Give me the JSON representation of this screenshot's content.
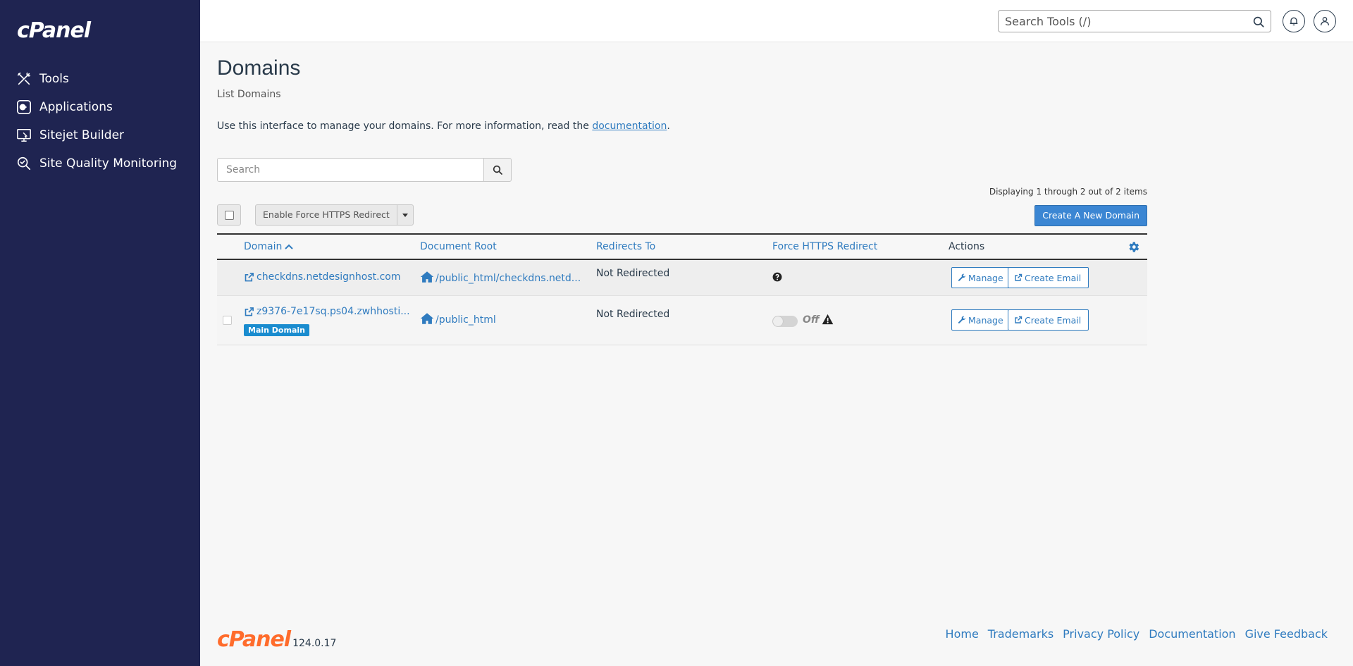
{
  "brand": {
    "logo_text": "cPanel"
  },
  "sidebar": {
    "items": [
      {
        "label": "Tools",
        "icon": "tools-icon"
      },
      {
        "label": "Applications",
        "icon": "applications-icon"
      },
      {
        "label": "Sitejet Builder",
        "icon": "sitejet-icon"
      },
      {
        "label": "Site Quality Monitoring",
        "icon": "site-quality-icon"
      }
    ]
  },
  "topbar": {
    "search_placeholder": "Search Tools (/)",
    "icons": [
      "search-icon",
      "bell-icon",
      "user-icon"
    ]
  },
  "page": {
    "title": "Domains",
    "subtitle": "List Domains",
    "intro_text": "Use this interface to manage your domains. For more information, read the ",
    "intro_link": "documentation",
    "intro_end": "."
  },
  "search": {
    "placeholder": "Search"
  },
  "list_info": {
    "displaying": "Displaying 1 through 2 out of 2 items"
  },
  "bulk": {
    "action_label": "Enable Force HTTPS Redirect"
  },
  "create_button": "Create A New Domain",
  "table": {
    "columns": {
      "domain": "Domain",
      "doc_root": "Document Root",
      "redirects": "Redirects To",
      "force_https": "Force HTTPS Redirect",
      "actions": "Actions"
    },
    "rows": [
      {
        "domain": "checkdns.netdesignhost.com",
        "doc_root": "/public_html/checkdns.netd...",
        "redirects": "Not Redirected",
        "https_status": "unknown",
        "manage": "Manage",
        "create_email": "Create Email"
      },
      {
        "domain": "z9376-7e17sq.ps04.zwhhosti...",
        "badge": "Main Domain",
        "doc_root": "/public_html",
        "redirects": "Not Redirected",
        "https_toggle": "Off",
        "manage": "Manage",
        "create_email": "Create Email"
      }
    ]
  },
  "footer": {
    "logo_text": "cPanel",
    "version": "124.0.17",
    "links": [
      "Home",
      "Trademarks",
      "Privacy Policy",
      "Documentation",
      "Give Feedback"
    ]
  },
  "colors": {
    "sidebar_bg": "#1f2451",
    "link": "#2f7bbf",
    "primary_button": "#3b86d3",
    "badge": "#1a8ccf",
    "footer_logo": "#ff6c2c"
  }
}
